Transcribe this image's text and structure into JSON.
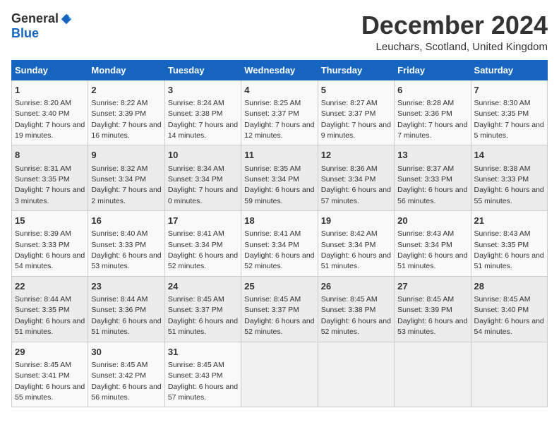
{
  "header": {
    "logo_general": "General",
    "logo_blue": "Blue",
    "month_title": "December 2024",
    "location": "Leuchars, Scotland, United Kingdom"
  },
  "calendar": {
    "days_of_week": [
      "Sunday",
      "Monday",
      "Tuesday",
      "Wednesday",
      "Thursday",
      "Friday",
      "Saturday"
    ],
    "weeks": [
      [
        {
          "day": "",
          "empty": true
        },
        {
          "day": "",
          "empty": true
        },
        {
          "day": "",
          "empty": true
        },
        {
          "day": "",
          "empty": true
        },
        {
          "day": "",
          "empty": true
        },
        {
          "day": "",
          "empty": true
        },
        {
          "day": "7",
          "sunrise": "8:30 AM",
          "sunset": "3:35 PM",
          "daylight": "7 hours and 5 minutes."
        }
      ],
      [
        {
          "day": "1",
          "sunrise": "8:20 AM",
          "sunset": "3:40 PM",
          "daylight": "7 hours and 19 minutes."
        },
        {
          "day": "2",
          "sunrise": "8:22 AM",
          "sunset": "3:39 PM",
          "daylight": "7 hours and 16 minutes."
        },
        {
          "day": "3",
          "sunrise": "8:24 AM",
          "sunset": "3:38 PM",
          "daylight": "7 hours and 14 minutes."
        },
        {
          "day": "4",
          "sunrise": "8:25 AM",
          "sunset": "3:37 PM",
          "daylight": "7 hours and 12 minutes."
        },
        {
          "day": "5",
          "sunrise": "8:27 AM",
          "sunset": "3:37 PM",
          "daylight": "7 hours and 9 minutes."
        },
        {
          "day": "6",
          "sunrise": "8:28 AM",
          "sunset": "3:36 PM",
          "daylight": "7 hours and 7 minutes."
        },
        {
          "day": "7",
          "sunrise": "8:30 AM",
          "sunset": "3:35 PM",
          "daylight": "7 hours and 5 minutes."
        }
      ],
      [
        {
          "day": "8",
          "sunrise": "8:31 AM",
          "sunset": "3:35 PM",
          "daylight": "7 hours and 3 minutes."
        },
        {
          "day": "9",
          "sunrise": "8:32 AM",
          "sunset": "3:34 PM",
          "daylight": "7 hours and 2 minutes."
        },
        {
          "day": "10",
          "sunrise": "8:34 AM",
          "sunset": "3:34 PM",
          "daylight": "7 hours and 0 minutes."
        },
        {
          "day": "11",
          "sunrise": "8:35 AM",
          "sunset": "3:34 PM",
          "daylight": "6 hours and 59 minutes."
        },
        {
          "day": "12",
          "sunrise": "8:36 AM",
          "sunset": "3:34 PM",
          "daylight": "6 hours and 57 minutes."
        },
        {
          "day": "13",
          "sunrise": "8:37 AM",
          "sunset": "3:33 PM",
          "daylight": "6 hours and 56 minutes."
        },
        {
          "day": "14",
          "sunrise": "8:38 AM",
          "sunset": "3:33 PM",
          "daylight": "6 hours and 55 minutes."
        }
      ],
      [
        {
          "day": "15",
          "sunrise": "8:39 AM",
          "sunset": "3:33 PM",
          "daylight": "6 hours and 54 minutes."
        },
        {
          "day": "16",
          "sunrise": "8:40 AM",
          "sunset": "3:33 PM",
          "daylight": "6 hours and 53 minutes."
        },
        {
          "day": "17",
          "sunrise": "8:41 AM",
          "sunset": "3:34 PM",
          "daylight": "6 hours and 52 minutes."
        },
        {
          "day": "18",
          "sunrise": "8:41 AM",
          "sunset": "3:34 PM",
          "daylight": "6 hours and 52 minutes."
        },
        {
          "day": "19",
          "sunrise": "8:42 AM",
          "sunset": "3:34 PM",
          "daylight": "6 hours and 51 minutes."
        },
        {
          "day": "20",
          "sunrise": "8:43 AM",
          "sunset": "3:34 PM",
          "daylight": "6 hours and 51 minutes."
        },
        {
          "day": "21",
          "sunrise": "8:43 AM",
          "sunset": "3:35 PM",
          "daylight": "6 hours and 51 minutes."
        }
      ],
      [
        {
          "day": "22",
          "sunrise": "8:44 AM",
          "sunset": "3:35 PM",
          "daylight": "6 hours and 51 minutes."
        },
        {
          "day": "23",
          "sunrise": "8:44 AM",
          "sunset": "3:36 PM",
          "daylight": "6 hours and 51 minutes."
        },
        {
          "day": "24",
          "sunrise": "8:45 AM",
          "sunset": "3:37 PM",
          "daylight": "6 hours and 51 minutes."
        },
        {
          "day": "25",
          "sunrise": "8:45 AM",
          "sunset": "3:37 PM",
          "daylight": "6 hours and 52 minutes."
        },
        {
          "day": "26",
          "sunrise": "8:45 AM",
          "sunset": "3:38 PM",
          "daylight": "6 hours and 52 minutes."
        },
        {
          "day": "27",
          "sunrise": "8:45 AM",
          "sunset": "3:39 PM",
          "daylight": "6 hours and 53 minutes."
        },
        {
          "day": "28",
          "sunrise": "8:45 AM",
          "sunset": "3:40 PM",
          "daylight": "6 hours and 54 minutes."
        }
      ],
      [
        {
          "day": "29",
          "sunrise": "8:45 AM",
          "sunset": "3:41 PM",
          "daylight": "6 hours and 55 minutes."
        },
        {
          "day": "30",
          "sunrise": "8:45 AM",
          "sunset": "3:42 PM",
          "daylight": "6 hours and 56 minutes."
        },
        {
          "day": "31",
          "sunrise": "8:45 AM",
          "sunset": "3:43 PM",
          "daylight": "6 hours and 57 minutes."
        },
        {
          "day": "",
          "empty": true
        },
        {
          "day": "",
          "empty": true
        },
        {
          "day": "",
          "empty": true
        },
        {
          "day": "",
          "empty": true
        }
      ]
    ]
  }
}
